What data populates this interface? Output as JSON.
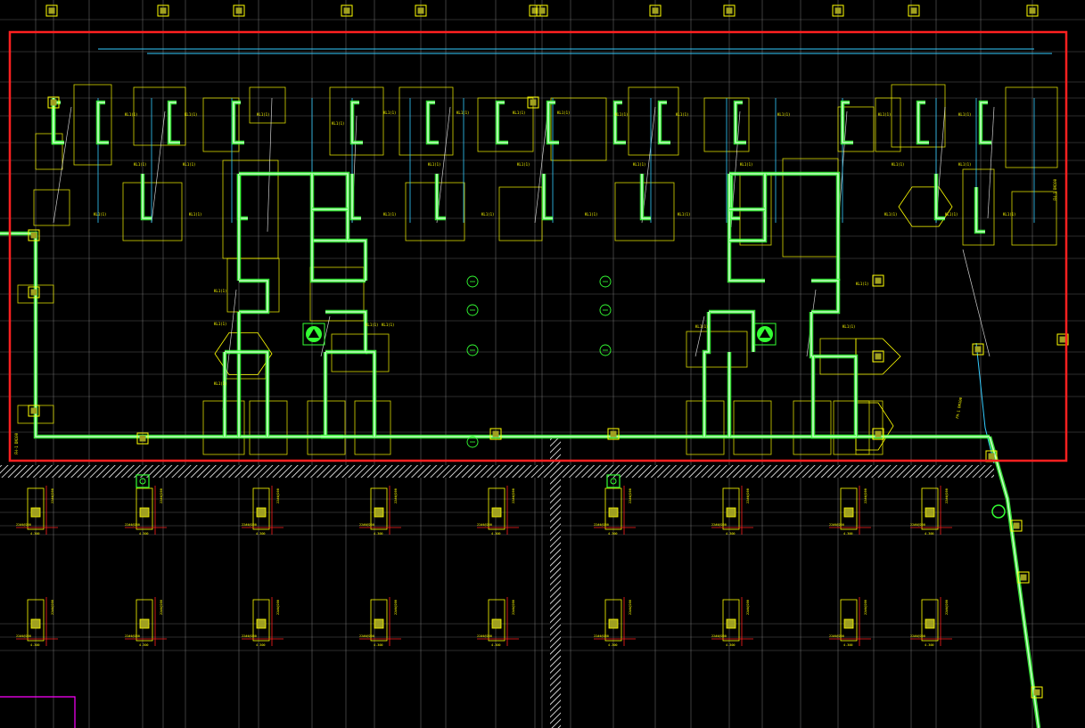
{
  "colors": {
    "background": "#000000",
    "grid": "#8a8a8a",
    "wall": "#c8ffc8",
    "wall_glow": "#3cff3c",
    "annotation": "#ffff00",
    "pipe": "#33ccff",
    "frame": "#ff2020",
    "hatch": "#ffffff",
    "corner": "#ff00ff"
  },
  "icons": {
    "column": "column-marker-icon",
    "fire_symbol": "fire-hydrant-icon",
    "drain": "floor-drain-icon"
  },
  "labels": {
    "pile_spec": "22#4@200",
    "pile_elev": "4.300",
    "beam_tag": "KL1(1)",
    "side_note": "FH-1 DN100"
  }
}
